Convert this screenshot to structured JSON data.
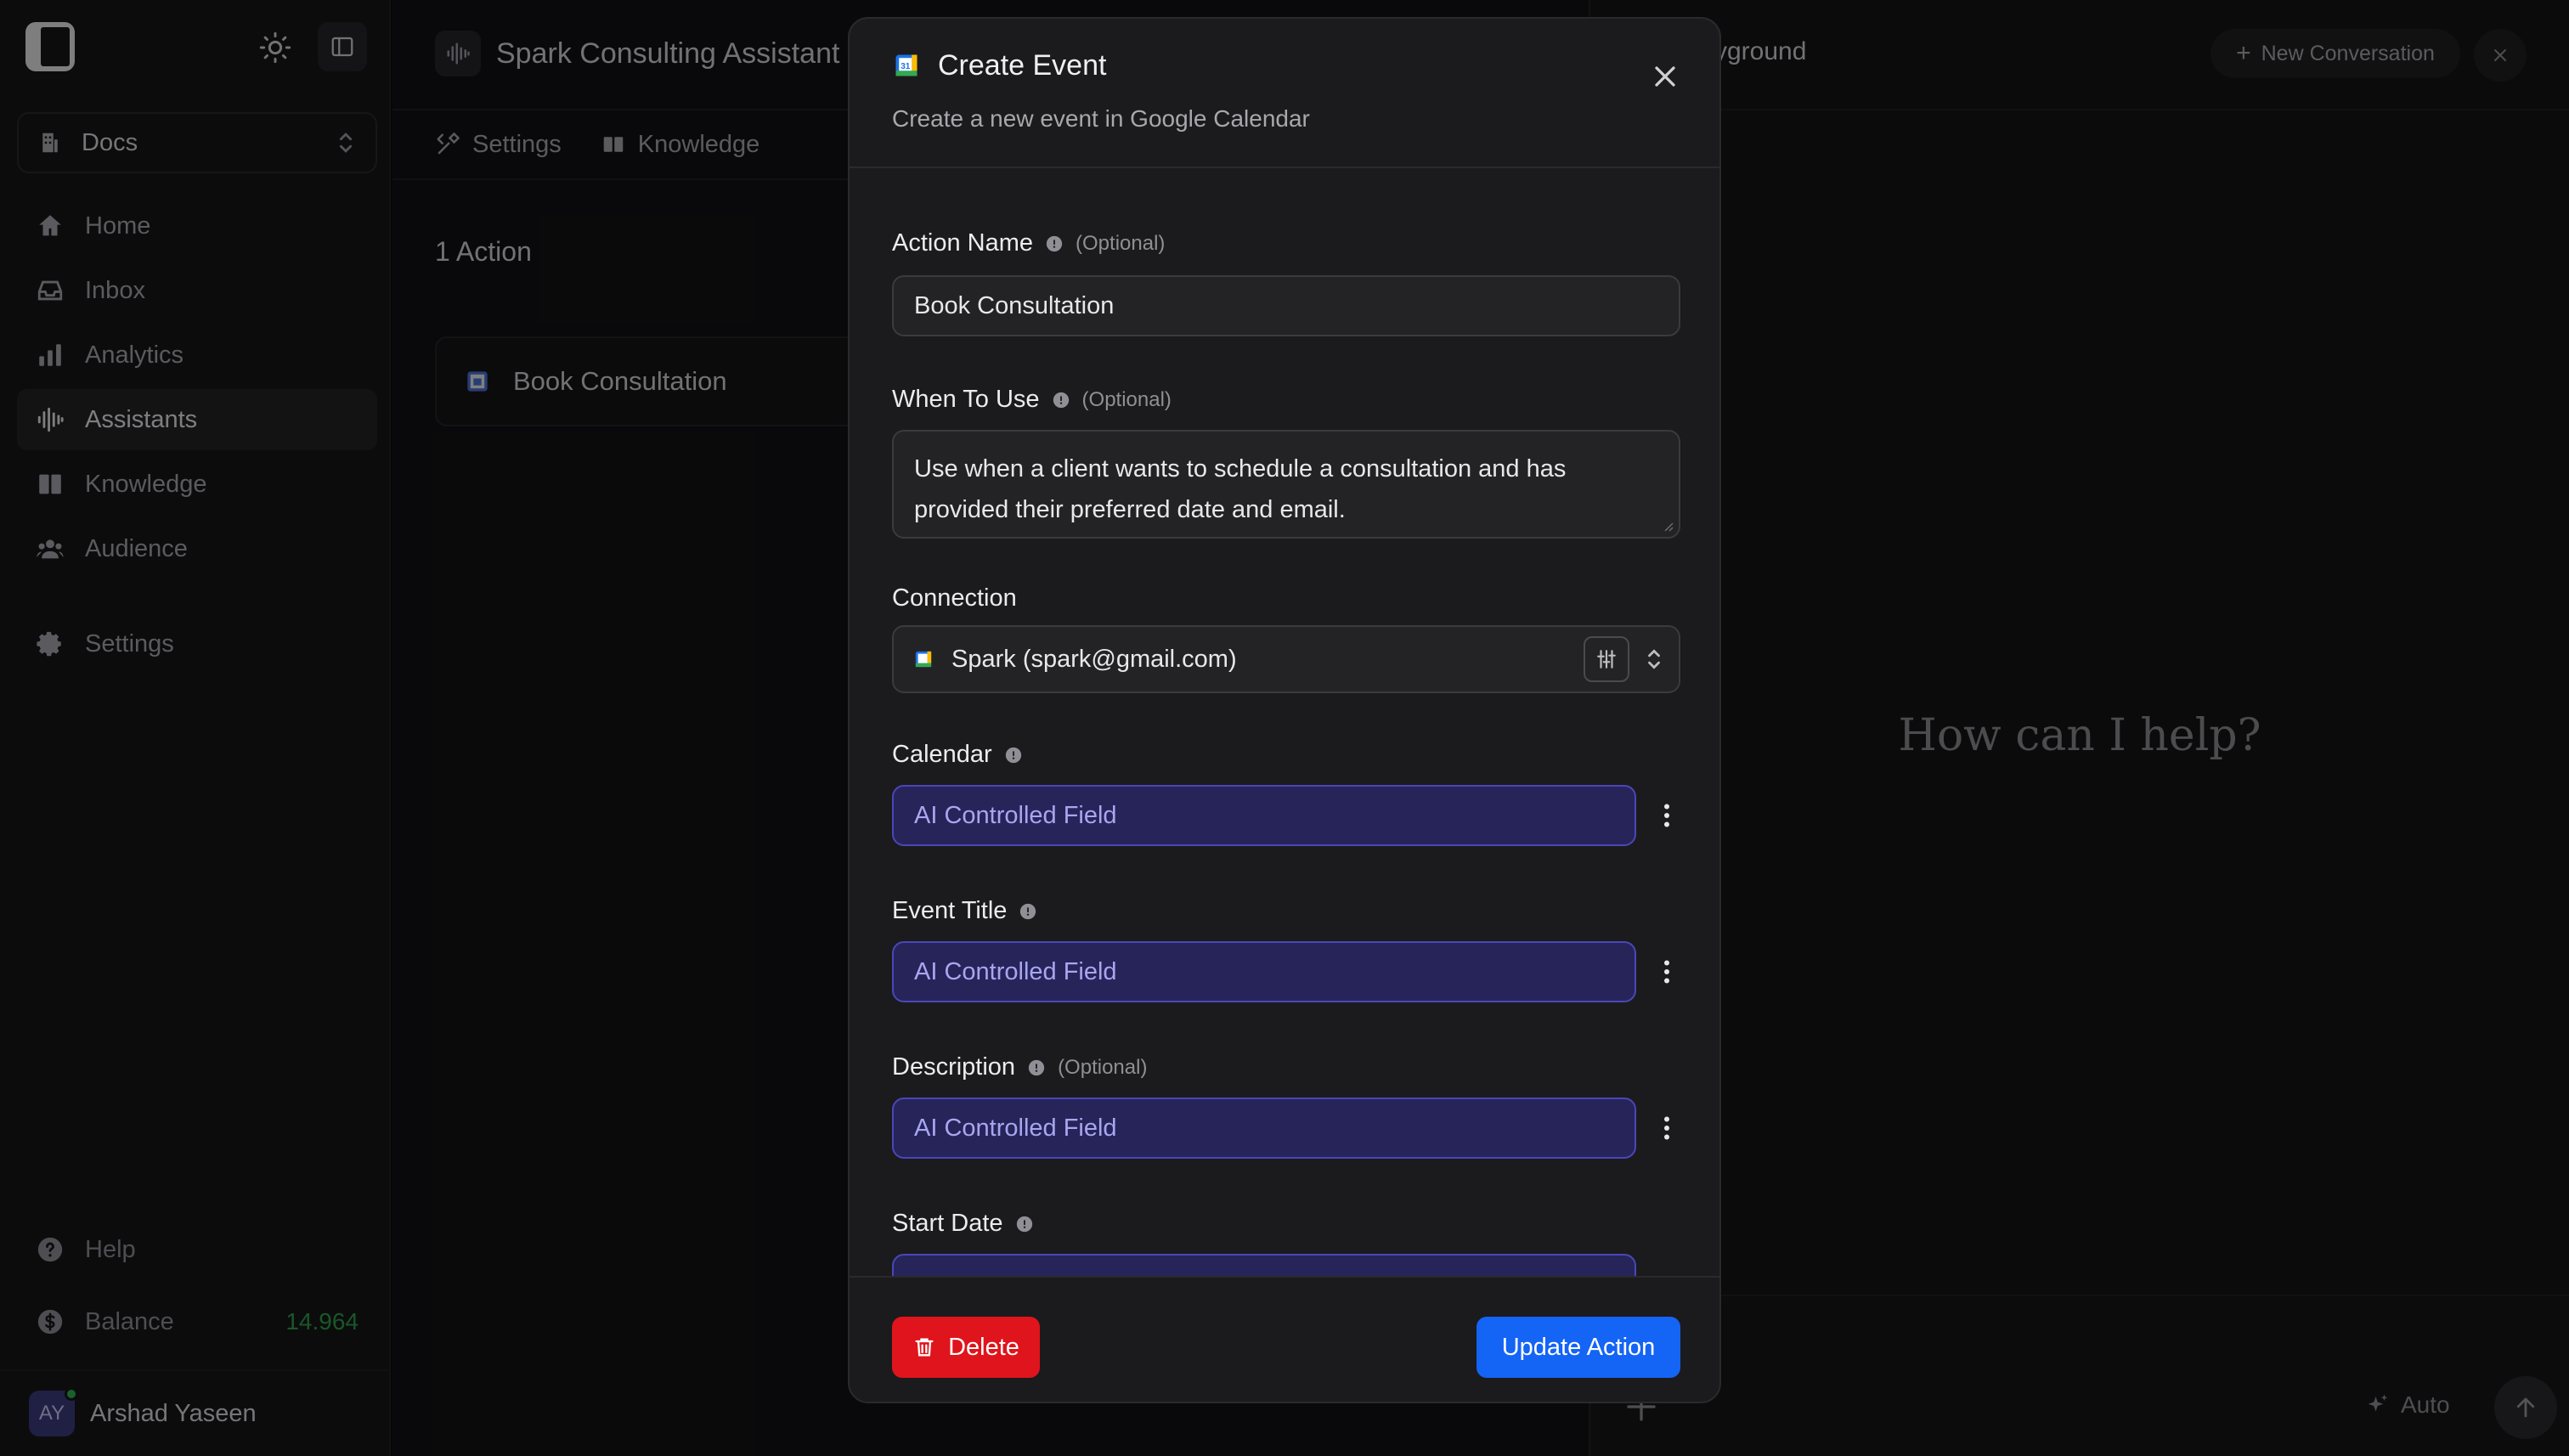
{
  "sidebar": {
    "workspace": "Docs",
    "nav": [
      {
        "label": "Home",
        "icon": "home-icon"
      },
      {
        "label": "Inbox",
        "icon": "inbox-icon"
      },
      {
        "label": "Analytics",
        "icon": "analytics-icon"
      },
      {
        "label": "Assistants",
        "icon": "waveform-icon",
        "active": true
      },
      {
        "label": "Knowledge",
        "icon": "book-icon"
      },
      {
        "label": "Audience",
        "icon": "users-icon"
      },
      {
        "label": "Settings",
        "icon": "gear-icon"
      }
    ],
    "help": "Help",
    "balance_label": "Balance",
    "balance_value": "14.964",
    "user": {
      "initials": "AY",
      "name": "Arshad Yaseen"
    }
  },
  "middle": {
    "assistant_title": "Spark Consulting Assistant",
    "tabs": [
      "Settings",
      "Knowledge"
    ],
    "actions_count": "1 Action",
    "action_card": "Book Consultation"
  },
  "right": {
    "title_fragment": "yground",
    "new_conversation": "New Conversation",
    "empty_prompt": "How can I help?",
    "mode": "Auto"
  },
  "modal": {
    "title": "Create Event",
    "subtitle": "Create a new event in Google Calendar",
    "optional_tag": "(Optional)",
    "action_name": {
      "label": "Action Name",
      "value": "Book Consultation"
    },
    "when_to_use": {
      "label": "When To Use",
      "value": "Use when a client wants to schedule a consultation and has provided their preferred date and email."
    },
    "connection": {
      "label": "Connection",
      "value": "Spark (spark@gmail.com)"
    },
    "calendar": {
      "label": "Calendar",
      "value": "AI Controlled Field"
    },
    "event_title": {
      "label": "Event Title",
      "value": "AI Controlled Field"
    },
    "description": {
      "label": "Description",
      "value": "AI Controlled Field"
    },
    "start_date": {
      "label": "Start Date"
    },
    "delete_label": "Delete",
    "update_label": "Update Action"
  },
  "colors": {
    "accent_blue": "#1464f5",
    "danger_red": "#e0141c",
    "ai_field_bg": "#27245a",
    "balance_green": "#2f9e4a"
  }
}
